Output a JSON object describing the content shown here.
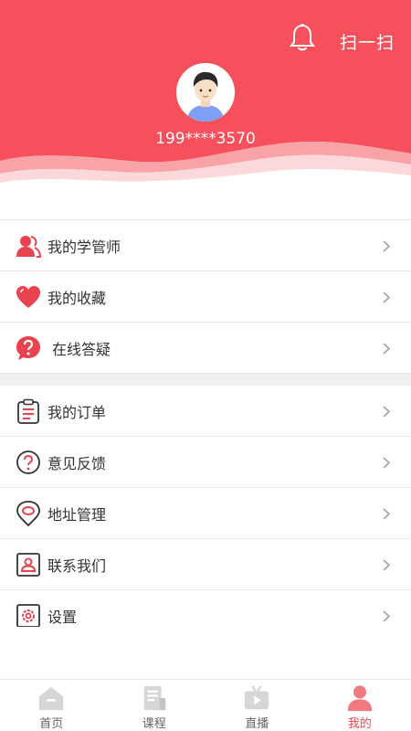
{
  "header": {
    "scan_label": "扫一扫",
    "phone": "199****3570",
    "accent": "#f5505b"
  },
  "menu_group_1": [
    {
      "label": "我的学管师",
      "icon": "user-tutor-icon"
    },
    {
      "label": "我的收藏",
      "icon": "heart-icon"
    },
    {
      "label": "在线答疑",
      "icon": "question-bubble-icon"
    }
  ],
  "menu_group_2": [
    {
      "label": "我的订单",
      "icon": "clipboard-icon"
    },
    {
      "label": "意见反馈",
      "icon": "question-circle-icon"
    },
    {
      "label": "地址管理",
      "icon": "location-icon"
    },
    {
      "label": "联系我们",
      "icon": "contact-card-icon"
    },
    {
      "label": "设置",
      "icon": "settings-gear-icon"
    }
  ],
  "tabs": [
    {
      "label": "首页",
      "icon": "home-icon",
      "active": false
    },
    {
      "label": "课程",
      "icon": "course-icon",
      "active": false
    },
    {
      "label": "直播",
      "icon": "live-tv-icon",
      "active": false
    },
    {
      "label": "我的",
      "icon": "profile-icon",
      "active": true
    }
  ]
}
